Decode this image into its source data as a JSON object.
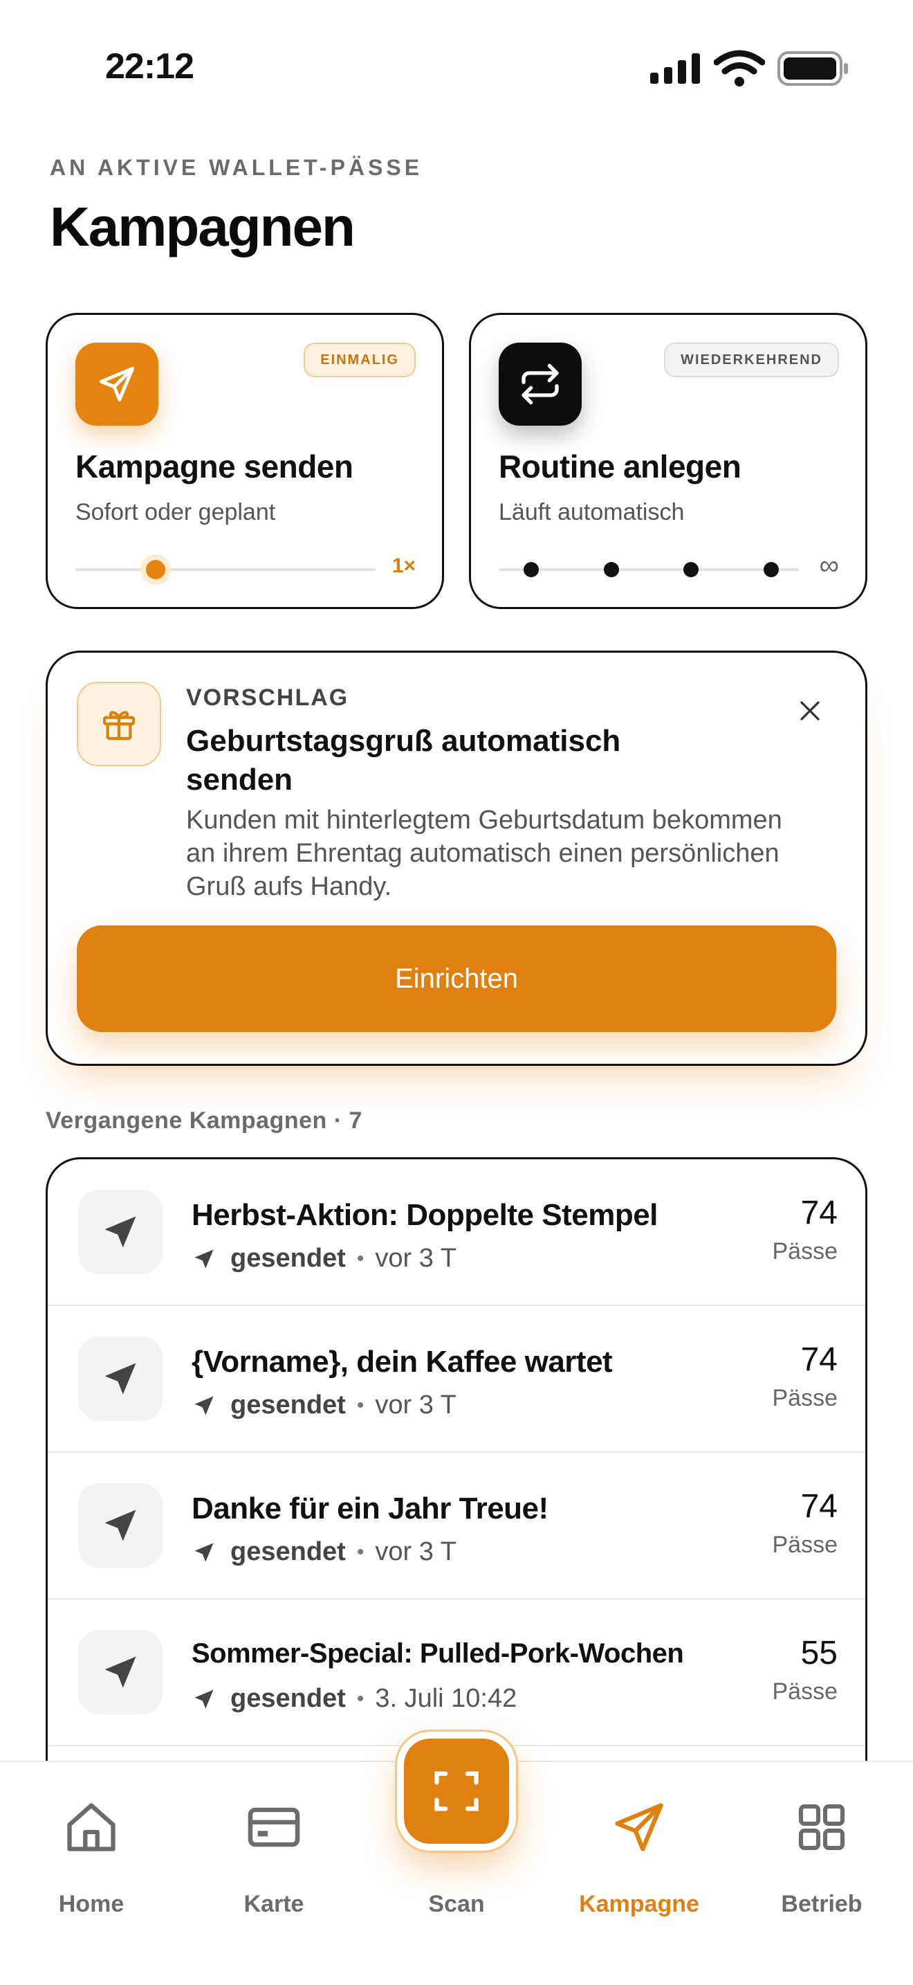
{
  "status_bar": {
    "time": "22:12"
  },
  "header": {
    "eyebrow": "AN AKTIVE WALLET-PÄSSE",
    "title": "Kampagnen"
  },
  "actions": {
    "send": {
      "badge": "EINMALIG",
      "title": "Kampagne senden",
      "subtitle": "Sofort oder geplant",
      "count": "1×",
      "icon": "paper-plane-icon"
    },
    "routine": {
      "badge": "WIEDERKEHREND",
      "title": "Routine anlegen",
      "subtitle": "Läuft automatisch",
      "count": "∞",
      "icon": "repeat-icon"
    }
  },
  "suggestion": {
    "label": "VORSCHLAG",
    "title": "Geburtstagsgruß automatisch senden",
    "text": "Kunden mit hinterlegtem Geburtsdatum bekommen an ihrem Ehrentag automatisch einen persönlichen Gruß aufs Handy.",
    "button": "Einrichten",
    "icon": "gift-icon"
  },
  "past": {
    "label": "Vergangene Kampagnen · 7",
    "items": [
      {
        "title": "Herbst-Aktion: Doppelte Stempel",
        "status": "gesendet",
        "time": "vor 3 T",
        "count": "74",
        "unit": "Pässe"
      },
      {
        "title": "{Vorname}, dein Kaffee wartet",
        "status": "gesendet",
        "time": "vor 3 T",
        "count": "74",
        "unit": "Pässe"
      },
      {
        "title": "Danke für ein Jahr Treue!",
        "status": "gesendet",
        "time": "vor 3 T",
        "count": "74",
        "unit": "Pässe"
      },
      {
        "title": "Sommer-Special: Pulled-Pork-Wochen",
        "status": "gesendet",
        "time": "3. Juli 10:42",
        "count": "55",
        "unit": "Pässe"
      }
    ]
  },
  "tabs": [
    {
      "label": "Home",
      "icon": "home-icon"
    },
    {
      "label": "Karte",
      "icon": "card-icon"
    },
    {
      "label": "Scan",
      "icon": "scan-icon"
    },
    {
      "label": "Kampagne",
      "icon": "paper-plane-icon",
      "active": true
    },
    {
      "label": "Betrieb",
      "icon": "grid-icon"
    }
  ],
  "colors": {
    "accent": "#e0810f",
    "text": "#111111",
    "muted": "#6b6b6b"
  }
}
